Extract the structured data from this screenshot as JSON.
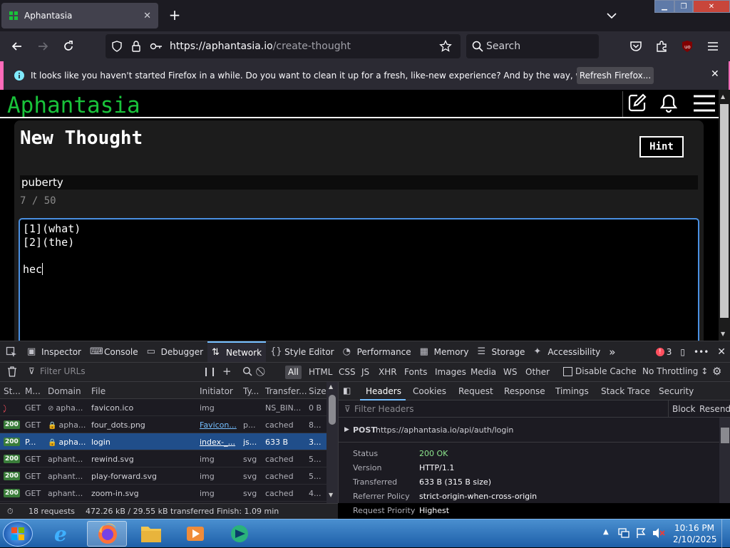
{
  "browser": {
    "tab_title": "Aphantasia",
    "url_host": "https://aphantasia.io",
    "url_path": "/create-thought",
    "search_placeholder": "Search",
    "notice_text": "It looks like you haven't started Firefox in a while. Do you want to clean it up for a fresh, like-new experience? And by the way, welcome back!",
    "notice_button": "Refresh Firefox..."
  },
  "app": {
    "brand": "Aphantasia",
    "page_title": "New Thought",
    "hint_button": "Hint",
    "title_value": "puberty",
    "counter": "7 / 50",
    "body_lines": [
      "[1](what)",
      "[2](the)",
      "",
      "hec"
    ]
  },
  "devtools": {
    "tabs": [
      "Inspector",
      "Console",
      "Debugger",
      "Network",
      "Style Editor",
      "Performance",
      "Memory",
      "Storage",
      "Accessibility"
    ],
    "selected_tab": "Network",
    "error_count": "3",
    "filter_placeholder": "Filter URLs",
    "type_filters": [
      "All",
      "HTML",
      "CSS",
      "JS",
      "XHR",
      "Fonts",
      "Images",
      "Media",
      "WS",
      "Other"
    ],
    "disable_cache": "Disable Cache",
    "throttling": "No Throttling ↕",
    "columns": [
      "St...",
      "M...",
      "Domain",
      "File",
      "Initiator",
      "Ty...",
      "Transfer...",
      "Size"
    ],
    "requests": [
      {
        "status": "",
        "method": "GET",
        "domain": "apha...",
        "file": "favicon.ico",
        "initiator": "img",
        "type": "",
        "transferred": "NS_BIN...",
        "size": "0 B"
      },
      {
        "status": "200",
        "method": "GET",
        "domain": "apha...",
        "file": "four_dots.png",
        "initiator": "Favicon...",
        "type": "p...",
        "transferred": "cached",
        "size": "8..."
      },
      {
        "status": "200",
        "method": "P...",
        "domain": "apha...",
        "file": "login",
        "initiator": "index-_...",
        "type": "js...",
        "transferred": "633 B",
        "size": "3..."
      },
      {
        "status": "200",
        "method": "GET",
        "domain": "aphant...",
        "file": "rewind.svg",
        "initiator": "img",
        "type": "svg",
        "transferred": "cached",
        "size": "5..."
      },
      {
        "status": "200",
        "method": "GET",
        "domain": "aphant...",
        "file": "play-forward.svg",
        "initiator": "img",
        "type": "svg",
        "transferred": "cached",
        "size": "5..."
      },
      {
        "status": "200",
        "method": "GET",
        "domain": "aphant...",
        "file": "zoom-in.svg",
        "initiator": "img",
        "type": "svg",
        "transferred": "cached",
        "size": "4..."
      }
    ],
    "detail_tabs": [
      "Headers",
      "Cookies",
      "Request",
      "Response",
      "Timings",
      "Stack Trace",
      "Security"
    ],
    "filter_headers": "Filter Headers",
    "block": "Block",
    "resend": "Resend",
    "post_method": "POST",
    "post_url": "https://aphantasia.io/api/auth/login",
    "headers": [
      {
        "k": "Status",
        "v": "200 OK"
      },
      {
        "k": "Version",
        "v": "HTTP/1.1"
      },
      {
        "k": "Transferred",
        "v": "633 B (315 B size)"
      },
      {
        "k": "Referrer Policy",
        "v": "strict-origin-when-cross-origin"
      },
      {
        "k": "Request Priority",
        "v": "Highest"
      }
    ],
    "status_requests": "18 requests",
    "status_transferred": "472.26 kB / 29.55 kB transferred",
    "status_finish": "Finish: 1.09 min"
  },
  "taskbar": {
    "time": "10:16 PM",
    "date": "2/10/2025"
  }
}
